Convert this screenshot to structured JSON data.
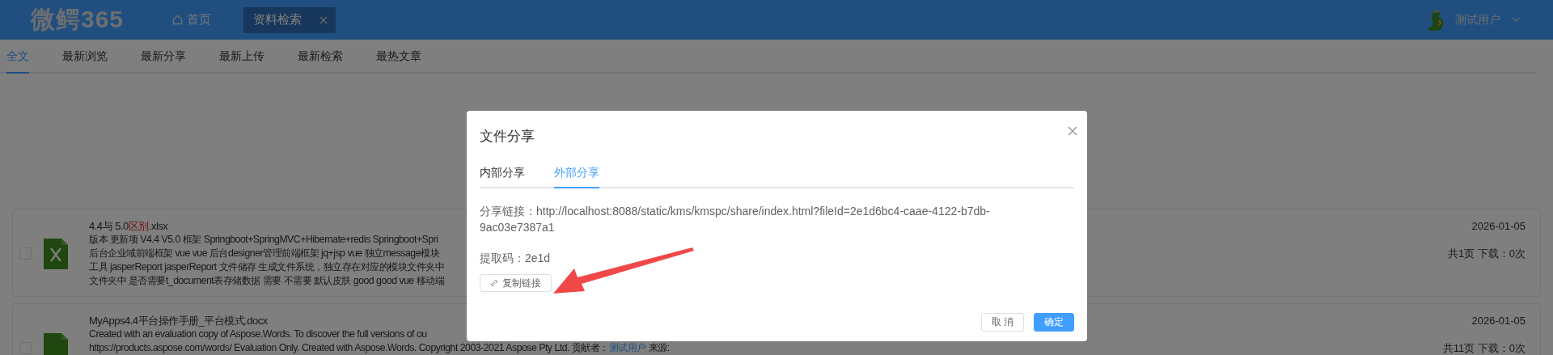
{
  "header": {
    "logo": "微鳄365",
    "home": "首页",
    "open_tabs": [
      {
        "label": "资料检索",
        "selected": true
      }
    ],
    "user": "测试用户"
  },
  "nav_tabs": [
    {
      "label": "全文",
      "selected": true
    },
    {
      "label": "最新浏览",
      "selected": false
    },
    {
      "label": "最新分享",
      "selected": false
    },
    {
      "label": "最新上传",
      "selected": false
    },
    {
      "label": "最新检索",
      "selected": false
    },
    {
      "label": "最热文章",
      "selected": false
    }
  ],
  "documents": [
    {
      "kind": "xlsx",
      "checked": false,
      "title": [
        {
          "text": "4.4与 5.0",
          "highlight": false
        },
        {
          "text": "区别",
          "highlight": true
        },
        {
          "text": ".xlsx",
          "highlight": false
        }
      ],
      "lines": [
        [
          {
            "text": "版本 更新项 V4.4 V5.0 框架 Springboot+SpringMVC+Hibernate+redis Springboot+Spri",
            "link": false
          }
        ],
        [
          {
            "text": "后台企业域前端框架 vue vue 后台designer管理前端框架 jq+jsp vue 独立message模块",
            "link": false
          }
        ],
        [
          {
            "text": "工具 jasperReport jasperReport 文件储存 生成文件系统，独立存在对应的模块文件夹中",
            "link": false
          }
        ],
        [
          {
            "text": "文件夹中 是否需要t_document表存储数据 需要 不需要 默认皮肤 good good vue 移动端",
            "link": false
          }
        ]
      ],
      "date": "2026-01-05",
      "stats": "共1页  下载：0次"
    },
    {
      "kind": "docx",
      "checked": false,
      "title": [
        {
          "text": "MyApps4.4平台操作手册_平台模式.docx",
          "highlight": false
        }
      ],
      "lines": [
        [
          {
            "text": "Created with an evaluation copy of Aspose.Words. To discover the full versions of ou",
            "link": false
          }
        ],
        [
          {
            "text": "https://products.aspose.com/words/ Evaluation Only. Created with Aspose.Words. Copyright 2003-2021 Aspose Pty Ltd.  贡献者：",
            "link": false
          },
          {
            "text": "测试用户",
            "link": true
          },
          {
            "text": "  来源:",
            "link": false
          }
        ]
      ],
      "date": "2026-01-05",
      "stats": "共11页  下载：0次"
    }
  ],
  "dialog": {
    "title": "文件分享",
    "tabs": [
      {
        "label": "内部分享",
        "selected": false
      },
      {
        "label": "外部分享",
        "selected": true
      }
    ],
    "link_label": "分享链接：",
    "link": "http://localhost:8088/static/kms/kmspc/share/index.html?fileId=2e1d6bc4-caae-4122-b7db-9ac03e7387a1",
    "code_label": "提取码：",
    "code": "2e1d",
    "copy_button": "复制链接",
    "buttons": [
      {
        "label": "取 消",
        "kind": "default"
      },
      {
        "label": "确定",
        "kind": "primary"
      }
    ]
  }
}
